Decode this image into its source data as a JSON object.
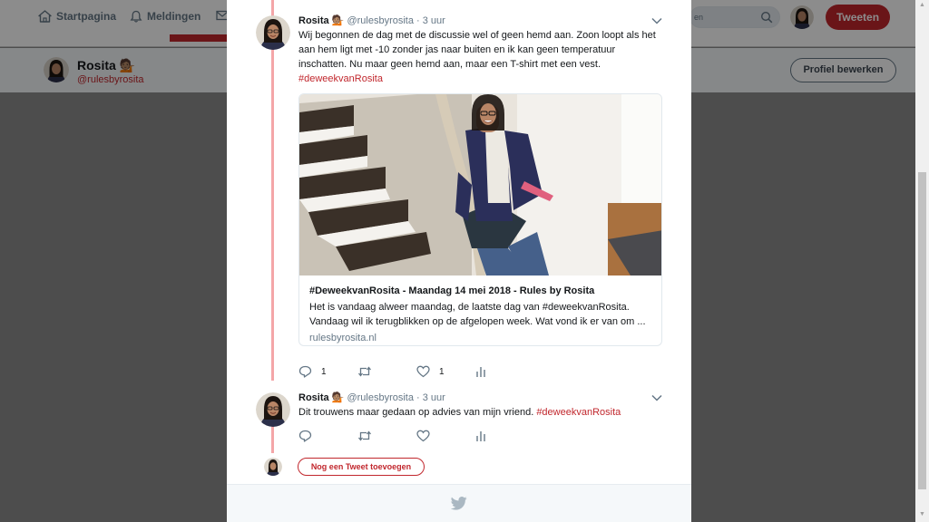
{
  "nav": {
    "home_label": "Startpagina",
    "notifications_label": "Meldingen",
    "search_placeholder": "en",
    "tweet_button_label": "Tweeten",
    "close_glyph": "✕"
  },
  "profile": {
    "name": "Rosita 💁🏽",
    "handle": "@rulesbyrosita",
    "edit_label": "Profiel bewerken"
  },
  "thread": {
    "tweets": [
      {
        "name": "Rosita 💁🏽",
        "meta": "@rulesbyrosita · 3 uur",
        "text": "Wij begonnen de dag met de discussie wel of geen hemd aan. Zoon loopt als het aan hem ligt met -10 zonder jas naar buiten en ik kan geen temperatuur inschatten. Nu maar geen hemd aan, maar een T-shirt met een vest.",
        "hashtag": "#deweekvanRosita",
        "card": {
          "title": "#DeweekvanRosita - Maandag 14 mei 2018 - Rules by Rosita",
          "description": "Het is vandaag alweer maandag, de laatste dag van #deweekvanRosita. Vandaag wil ik terugblikken op de afgelopen week. Wat vond ik er van om ...",
          "url": "rulesbyrosita.nl"
        },
        "reply_count": "1",
        "retweet_count": "",
        "like_count": "1"
      },
      {
        "name": "Rosita 💁🏽",
        "meta": "@rulesbyrosita · 3 uur",
        "text": "Dit trouwens maar gedaan op advies van mijn vriend.",
        "hashtag": "#deweekvanRosita",
        "reply_count": "",
        "retweet_count": "",
        "like_count": ""
      }
    ],
    "add_tweet_label": "Nog een Tweet toevoegen"
  },
  "colors": {
    "accent": "#c1272d",
    "thread_line": "#f4a6a8",
    "secondary_text": "#657786"
  },
  "icons": [
    "home-icon",
    "bell-icon",
    "mail-icon",
    "search-icon",
    "close-icon",
    "chevron-down-icon",
    "reply-icon",
    "retweet-icon",
    "like-icon",
    "analytics-icon",
    "twitter-bird-icon"
  ]
}
